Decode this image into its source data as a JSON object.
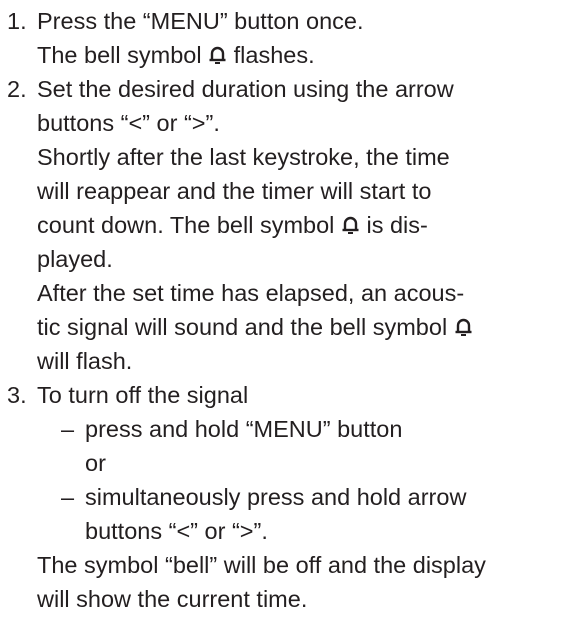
{
  "instructions": {
    "step1": {
      "number": "1.",
      "text": "Press the “MENU” button once.",
      "result_before": "The bell symbol",
      "result_after": "flashes."
    },
    "step2": {
      "number": "2.",
      "text_line1": "Set the desired duration using the arrow",
      "text_line2": "buttons “<” or “>”.",
      "para1_line1": "Shortly after the last keystroke, the time",
      "para1_line2": "will reappear and the timer will start to",
      "para1_line3_before": "count down. The bell symbol",
      "para1_line3_after": "is dis-",
      "para1_line4": "played.",
      "para2_line1": "After the set time has elapsed, an acous-",
      "para2_line2": "tic signal will sound and the bell symbol",
      "para2_line3": "will flash."
    },
    "step3": {
      "number": "3.",
      "text": "To turn off the signal",
      "dash": "–",
      "option1": "press and hold “MENU” button",
      "or": "or",
      "option2_line1": "simultaneously press and hold arrow",
      "option2_line2": "buttons “<” or “>”.",
      "result_line1": "The symbol “bell” will be off and the display",
      "result_line2": "will show the current time."
    }
  }
}
